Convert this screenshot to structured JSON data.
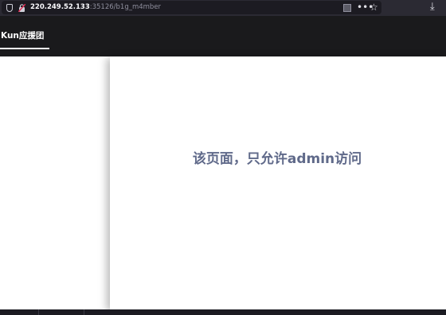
{
  "browser": {
    "url_host": "220.249.52.133",
    "url_path": ":35126/b1g_m4mber",
    "more_glyph": "•••",
    "star_glyph": "☆",
    "download_glyph": "⤓"
  },
  "navbar": {
    "brand": "Kun应援团"
  },
  "main": {
    "message": "该页面，只允许admin访问"
  },
  "colors": {
    "toolbar_bg": "#2b2a33",
    "navbar_bg": "#1a1a1c",
    "message_color": "#606a8a"
  }
}
